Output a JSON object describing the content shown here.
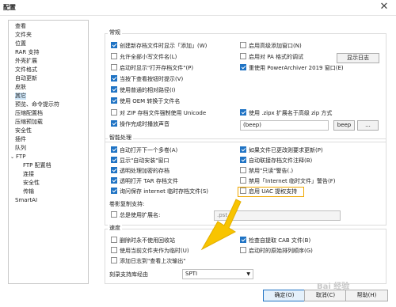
{
  "window": {
    "title": "配置",
    "close_glyph": "✕"
  },
  "sidebar": {
    "items": [
      {
        "label": "查看"
      },
      {
        "label": "文件夹"
      },
      {
        "label": "位置"
      },
      {
        "label": "RAR 支持"
      },
      {
        "label": "外壳扩展"
      },
      {
        "label": "文件格式"
      },
      {
        "label": "自动更新"
      },
      {
        "label": "皮肤"
      },
      {
        "label": "其它"
      },
      {
        "label": "预览、命令提示符"
      },
      {
        "label": "压缩配置档"
      },
      {
        "label": "压缩预加载"
      },
      {
        "label": "安全性"
      },
      {
        "label": "插件"
      },
      {
        "label": "队列"
      },
      {
        "label": "FTP"
      },
      {
        "label": "FTP 配置档"
      },
      {
        "label": "连接"
      },
      {
        "label": "安全性"
      },
      {
        "label": "传输"
      },
      {
        "label": "SmartAI"
      }
    ],
    "ftp_toggle": "⌄"
  },
  "sections": {
    "general": "常规",
    "smart": "智能处理",
    "speed": "速度"
  },
  "general": {
    "opt1": "创建新存档文件时显示「添加」(W)",
    "opt2": "允许全部小写文件名(L)",
    "opt3": "启动时显示\"打开存档文件\"(P)",
    "opt4": "当按下查看按钮时提示(V)",
    "opt5": "使用普通的相对路径(I)",
    "opt6": "使用 OEM 转换于文件名",
    "opt7": "对 ZIP 存档文件强制使用 Unicode",
    "opt8": "操作完成时播放声音",
    "opt9": "启用高级添加窗口(N)",
    "opt10": "启用对 PA 格式的调试",
    "opt11": "重使用 PowerArchiver 2019 窗口(E)",
    "opt12": "使用 .zipx 扩展名于高级 zip 方式",
    "show_log_btn": "显示日志",
    "sound_value": "(beep)",
    "beep_btn": "beep",
    "browse_btn": "..."
  },
  "smart": {
    "opt1": "自动打开下一个多卷(A)",
    "opt2": "显示\"自动安装\"窗口",
    "opt3": "透明处理加密的存档",
    "opt4": "透明打开 TAR 存档文件",
    "opt5": "询问保存 internet 临时存档文件(S)",
    "opt6": "如果文件已更改则要求更新(P)",
    "opt7": "自动联接存档文件注释(B)",
    "opt8": "禁用\"只读\"警告(.)",
    "opt9": "禁用「Internet 临时文件」警告(F)",
    "opt10": "启用 UAC 提权支持",
    "lbl_copy": "卷影复制支持:",
    "opt11": "总是使用扩展名:",
    "ext_value": ".pst"
  },
  "speed": {
    "opt1": "删除时永不使用回收站",
    "opt2": "使用当前文件夹作为临时(U)",
    "opt3": "添加日志到\"查看上次输出\"",
    "opt4": "检查自提取 CAB 文件(B)",
    "opt5": "启动时的原始排列顺序(G)",
    "lbl_engine": "刻录支持库经由",
    "engine_value": "SPTI"
  },
  "buttons": {
    "ok": "确定(O)",
    "cancel": "取消(C)",
    "help": "帮助(H)"
  },
  "watermark": "Bai 经验"
}
